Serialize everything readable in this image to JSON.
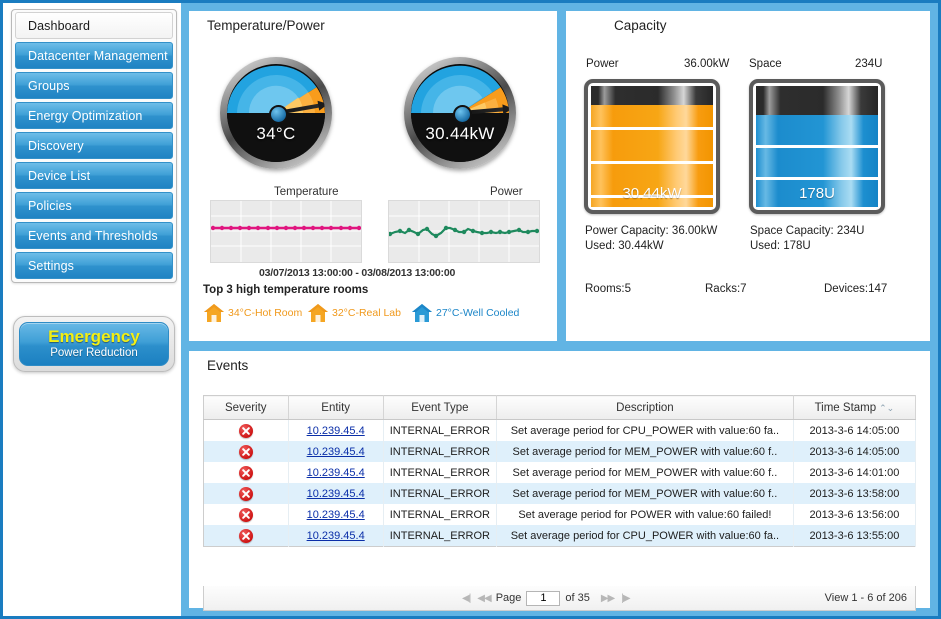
{
  "sidebar": {
    "items": [
      {
        "label": "Dashboard",
        "active": true
      },
      {
        "label": "Datacenter Management",
        "active": false
      },
      {
        "label": "Groups",
        "active": false
      },
      {
        "label": "Energy Optimization",
        "active": false
      },
      {
        "label": "Discovery",
        "active": false
      },
      {
        "label": "Device List",
        "active": false
      },
      {
        "label": "Policies",
        "active": false
      },
      {
        "label": "Events and Thresholds",
        "active": false
      },
      {
        "label": "Settings",
        "active": false
      }
    ],
    "emergency": {
      "line1": "Emergency",
      "line2": "Power Reduction"
    }
  },
  "temp_power": {
    "tab_title": "Temperature/Power",
    "gauges": [
      {
        "name": "temperature",
        "value": "34°C",
        "caption": "Temperature",
        "needle_deg": -10,
        "orange_start_deg": 36,
        "orange_end_deg": 0
      },
      {
        "name": "power",
        "value": "30.44kW",
        "caption": "Power",
        "needle_deg": -5,
        "orange_start_deg": 34,
        "orange_end_deg": 0
      }
    ],
    "range_label": "03/07/2013 13:00:00 - 03/08/2013 13:00:00",
    "top3_label": "Top 3 high temperature rooms",
    "rooms": [
      {
        "label": "34°C-Hot Room",
        "color": "#f0991c",
        "tone": "orange"
      },
      {
        "label": "32°C-Real Lab",
        "color": "#f0991c",
        "tone": "orange"
      },
      {
        "label": "27°C-Well Cooled",
        "color": "#1c86c8",
        "tone": "blue"
      }
    ]
  },
  "chart_data": [
    {
      "type": "line",
      "title": "Temperature",
      "xlabel": "",
      "ylabel": "",
      "series_color": "#e0157f",
      "x": [
        0,
        1,
        2,
        3,
        4,
        5,
        6,
        7,
        8,
        9,
        10,
        11,
        12,
        13,
        14,
        15,
        16,
        17,
        18,
        19,
        20,
        21,
        22,
        23,
        24,
        25,
        26,
        27,
        28,
        29,
        30,
        31
      ],
      "values": [
        34,
        34,
        34,
        34,
        34,
        34,
        34,
        34,
        34,
        34,
        34,
        34,
        34,
        34,
        34,
        34,
        34,
        34,
        34,
        34,
        34,
        34,
        34,
        34,
        34,
        34,
        34,
        34,
        34,
        34,
        34,
        34
      ],
      "ylim": [
        30,
        38
      ],
      "grid": true,
      "x_range_label": "03/07/2013 13:00:00 - 03/08/2013 13:00:00"
    },
    {
      "type": "line",
      "title": "Power",
      "xlabel": "",
      "ylabel": "",
      "series_color": "#1f8a5e",
      "x": [
        0,
        1,
        2,
        3,
        4,
        5,
        6,
        7,
        8,
        9,
        10,
        11,
        12,
        13,
        14,
        15,
        16,
        17,
        18,
        19,
        20,
        21,
        22,
        23,
        24,
        25,
        26,
        27,
        28,
        29,
        30,
        31
      ],
      "values": [
        30.2,
        30.5,
        30.8,
        30.4,
        30.9,
        30.7,
        30.3,
        30.9,
        31.1,
        30.2,
        29.9,
        30.4,
        31.2,
        31.3,
        30.9,
        30.7,
        30.6,
        31.2,
        30.8,
        30.5,
        30.4,
        30.3,
        30.5,
        30.4,
        30.6,
        30.3,
        30.5,
        30.7,
        31.0,
        30.6,
        30.5,
        30.6
      ],
      "ylim": [
        28,
        34
      ],
      "grid": true,
      "x_range_label": "03/07/2013 13:00:00 - 03/08/2013 13:00:00"
    },
    {
      "type": "bar",
      "title": "Capacity",
      "categories": [
        "Power",
        "Space"
      ],
      "series": [
        {
          "name": "Used",
          "values": [
            30.44,
            178
          ]
        },
        {
          "name": "Capacity",
          "values": [
            36.0,
            234
          ]
        }
      ],
      "units": [
        "kW",
        "U"
      ],
      "fill_percent": [
        84.6,
        76.1
      ]
    }
  ],
  "capacity": {
    "tab_title": "Capacity",
    "power": {
      "head_label": "Power",
      "head_value": "36.00kW",
      "bar_value": "30.44kW",
      "fill_percent": 84.6,
      "capacity_line": "Power Capacity: 36.00kW",
      "used_line": "Used: 30.44kW",
      "color": "#f7a615"
    },
    "space": {
      "head_label": "Space",
      "head_value": "234U",
      "bar_value": "178U",
      "fill_percent": 76.1,
      "capacity_line": "Space Capacity: 234U",
      "used_line": "Used: 178U",
      "color": "#2295d4"
    },
    "stats": [
      {
        "label": "Rooms:5"
      },
      {
        "label": "Racks:7"
      },
      {
        "label": "Devices:147"
      }
    ]
  },
  "events": {
    "tab_title": "Events",
    "columns": [
      "Severity",
      "Entity",
      "Event Type",
      "Description",
      "Time Stamp"
    ],
    "sort_column": "Time Stamp",
    "rows": [
      {
        "severity": "error",
        "entity": "10.239.45.4",
        "event_type": "INTERNAL_ERROR",
        "description": "Set average period for CPU_POWER with value:60 fa..",
        "timestamp": "2013-3-6 14:05:00"
      },
      {
        "severity": "error",
        "entity": "10.239.45.4",
        "event_type": "INTERNAL_ERROR",
        "description": "Set average period for MEM_POWER with value:60 f..",
        "timestamp": "2013-3-6 14:05:00"
      },
      {
        "severity": "error",
        "entity": "10.239.45.4",
        "event_type": "INTERNAL_ERROR",
        "description": "Set average period for MEM_POWER with value:60 f..",
        "timestamp": "2013-3-6 14:01:00"
      },
      {
        "severity": "error",
        "entity": "10.239.45.4",
        "event_type": "INTERNAL_ERROR",
        "description": "Set average period for MEM_POWER with value:60 f..",
        "timestamp": "2013-3-6 13:58:00"
      },
      {
        "severity": "error",
        "entity": "10.239.45.4",
        "event_type": "INTERNAL_ERROR",
        "description": "Set average period for POWER with value:60 failed!",
        "timestamp": "2013-3-6 13:56:00"
      },
      {
        "severity": "error",
        "entity": "10.239.45.4",
        "event_type": "INTERNAL_ERROR",
        "description": "Set average period for CPU_POWER with value:60 fa..",
        "timestamp": "2013-3-6 13:55:00"
      }
    ],
    "pager": {
      "first_icon": "◀|",
      "prev_icon": "◀◀",
      "page_label": "Page",
      "page_value": "1",
      "of_label": "of 35",
      "next_icon": "▶▶",
      "last_icon": "|▶",
      "view_label": "View 1 - 6 of 206"
    }
  }
}
